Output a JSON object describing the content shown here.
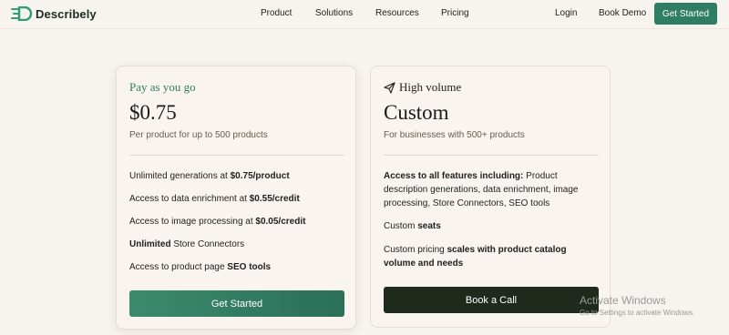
{
  "nav": {
    "logo": "Describely",
    "links": [
      "Product",
      "Solutions",
      "Resources",
      "Pricing"
    ],
    "login": "Login",
    "book_demo": "Book Demo",
    "get_started": "Get Started"
  },
  "cards": [
    {
      "tier": "Pay as you go",
      "price": "$0.75",
      "subtitle": "Per product for up to 500 products",
      "features": [
        {
          "pre": "Unlimited generations at ",
          "bold": "$0.75/product",
          "post": ""
        },
        {
          "pre": "Access to data enrichment at ",
          "bold": "$0.55/credit",
          "post": ""
        },
        {
          "pre": "Access to image processing at ",
          "bold": "$0.05/credit",
          "post": ""
        },
        {
          "pre": "",
          "bold": "Unlimited",
          "post": " Store Connectors"
        },
        {
          "pre": "Access to product page ",
          "bold": "SEO tools",
          "post": ""
        }
      ],
      "cta": "Get Started"
    },
    {
      "tier": "High volume",
      "price": "Custom",
      "subtitle": "For businesses with 500+ products",
      "features": [
        {
          "pre": "",
          "bold": "Access to all features including:",
          "post": " Product description generations, data enrichment, image processing, Store Connectors, SEO tools"
        },
        {
          "pre": "Custom ",
          "bold": "seats",
          "post": ""
        },
        {
          "pre": "Custom pricing ",
          "bold": "scales with product catalog volume and needs",
          "post": ""
        }
      ],
      "cta": "Book a Call"
    }
  ],
  "watermark": {
    "title": "Activate Windows",
    "subtitle": "Go to Settings to activate Windows."
  },
  "colors": {
    "background": "#f7f3ee",
    "accent": "#2f7d64",
    "dark_button": "#1f2a1c"
  },
  "icons": {
    "logo": "describely-logo-icon",
    "high_volume": "paper-plane-icon"
  }
}
